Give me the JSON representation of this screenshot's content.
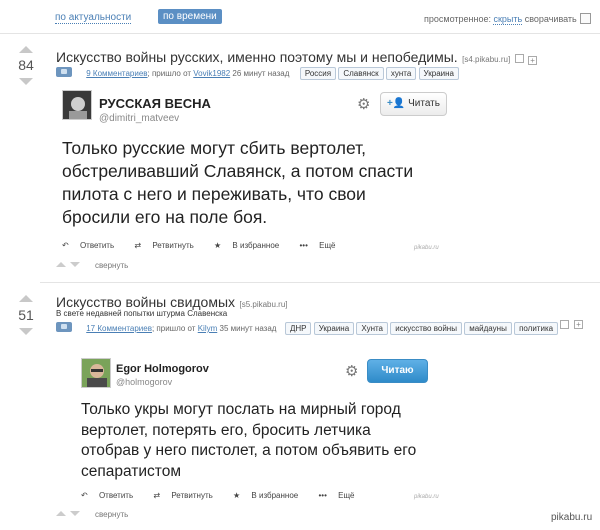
{
  "sort": {
    "by_relevance": "по актуальности",
    "by_time": "по времени",
    "viewed_label": "просмотренное:",
    "hide_link": "скрыть",
    "collapse_label": "сворачивать"
  },
  "posts": [
    {
      "rating": "84",
      "title": "Искусство войны русских, именно поэтому мы и непобедимы.",
      "domain": "[s4.pikabu.ru]",
      "subtitle": "",
      "comments": "9 Комментариев",
      "posted_prefix": "; пришло от",
      "author": "Vovik1982",
      "time": "26 минут назад",
      "tags": [
        "Россия",
        "Славянск",
        "хунта",
        "Украина"
      ],
      "tweet": {
        "name": "РУССКАЯ ВЕСНА",
        "handle": "@dimitri_matveev",
        "follow_label": "Читать",
        "text": "Только русские могут сбить вертолет, обстреливавший Славянск, а потом спасти пилота с него и переживать, что свои бросили его на поле боя.",
        "reply": "Ответить",
        "retweet": "Ретвитнуть",
        "favorite": "В избранное",
        "more": "Ещё",
        "watermark": "pikabu.ru"
      },
      "collapse": "свернуть"
    },
    {
      "rating": "51",
      "title": "Искусство войны свидомых",
      "domain": "[s5.pikabu.ru]",
      "subtitle": "В свете недавней попытки штурма Славенска",
      "comments": "17 Комментариев",
      "posted_prefix": "; пришло от",
      "author": "Kilym",
      "time": "35 минут назад",
      "tags": [
        "ДНР",
        "Украина",
        "Хунта",
        "искусство войны",
        "майдауны",
        "политика"
      ],
      "tweet": {
        "name": "Egor Holmogorov",
        "handle": "@holmogorov",
        "follow_label": "Читаю",
        "text": "Только укры могут послать на мирный город вертолет, потерять его, бросить летчика отобрав у него пистолет, а потом объявить его сепаратистом",
        "reply": "Ответить",
        "retweet": "Ретвитнуть",
        "favorite": "В избранное",
        "more": "Ещё",
        "watermark": "pikabu.ru"
      },
      "collapse": "свернуть"
    }
  ],
  "footer_watermark": "pikabu.ru",
  "colors": {
    "link": "#4a7fb5",
    "active_tab": "#5b8fc4",
    "follow_blue": "#2f8bc9"
  }
}
